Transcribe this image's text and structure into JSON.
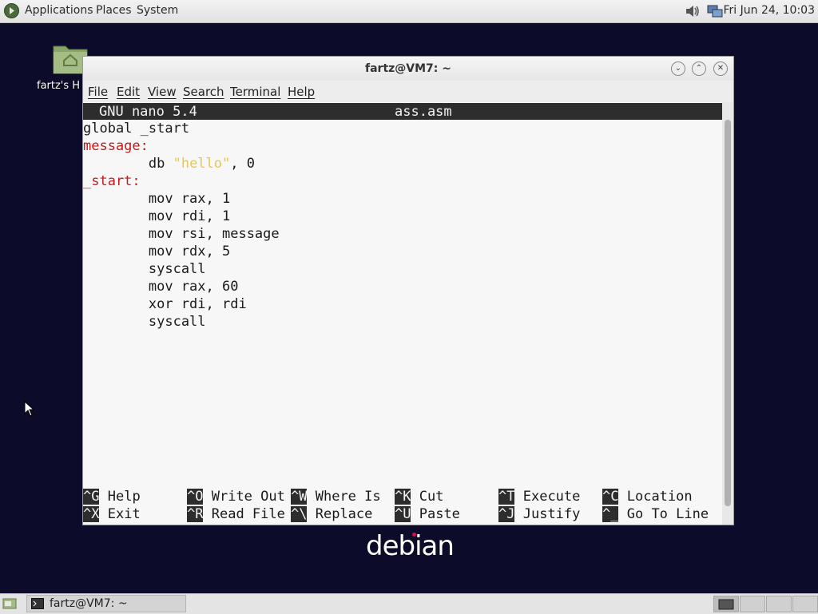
{
  "top_panel": {
    "menus": [
      "Applications",
      "Places",
      "System"
    ],
    "clock": "Fri Jun 24, 10:03",
    "icons": [
      "distro-icon",
      "volume-icon",
      "network-icon"
    ]
  },
  "desktop": {
    "home_label": "fartz's H",
    "logo_text": "debian"
  },
  "window": {
    "title": "fartz@VM7: ~",
    "menu": [
      "File",
      "Edit",
      "View",
      "Search",
      "Terminal",
      "Help"
    ]
  },
  "nano": {
    "version": "GNU nano 5.4",
    "filename": "ass.asm",
    "lines": [
      {
        "text": "global _start"
      },
      {
        "label": "message:"
      },
      {
        "pre": "        db ",
        "str": "\"hello\"",
        "post": ", 0"
      },
      {
        "label": "_start:"
      },
      {
        "text": "        mov rax, 1"
      },
      {
        "text": "        mov rdi, 1"
      },
      {
        "text": "        mov rsi, message"
      },
      {
        "text": "        mov rdx, 5"
      },
      {
        "text": "        syscall"
      },
      {
        "text": "        mov rax, 60"
      },
      {
        "text": "        xor rdi, rdi"
      },
      {
        "text": "        syscall"
      }
    ],
    "shortcuts": [
      [
        {
          "key": "^G",
          "label": "Help"
        },
        {
          "key": "^O",
          "label": "Write Out"
        },
        {
          "key": "^W",
          "label": "Where Is"
        },
        {
          "key": "^K",
          "label": "Cut"
        },
        {
          "key": "^T",
          "label": "Execute"
        },
        {
          "key": "^C",
          "label": "Location"
        }
      ],
      [
        {
          "key": "^X",
          "label": "Exit"
        },
        {
          "key": "^R",
          "label": "Read File"
        },
        {
          "key": "^\\",
          "label": "Replace"
        },
        {
          "key": "^U",
          "label": "Paste"
        },
        {
          "key": "^J",
          "label": "Justify"
        },
        {
          "key": "^_",
          "label": "Go To Line"
        }
      ]
    ]
  },
  "taskbar": {
    "item_label": "fartz@VM7: ~"
  },
  "colors": {
    "desktop_bg": "#0c0c2a",
    "label_red": "#c51a1a",
    "string_yellow": "#e8c84a",
    "nano_bar": "#2d2d2d",
    "debian_red": "#d70a53"
  }
}
